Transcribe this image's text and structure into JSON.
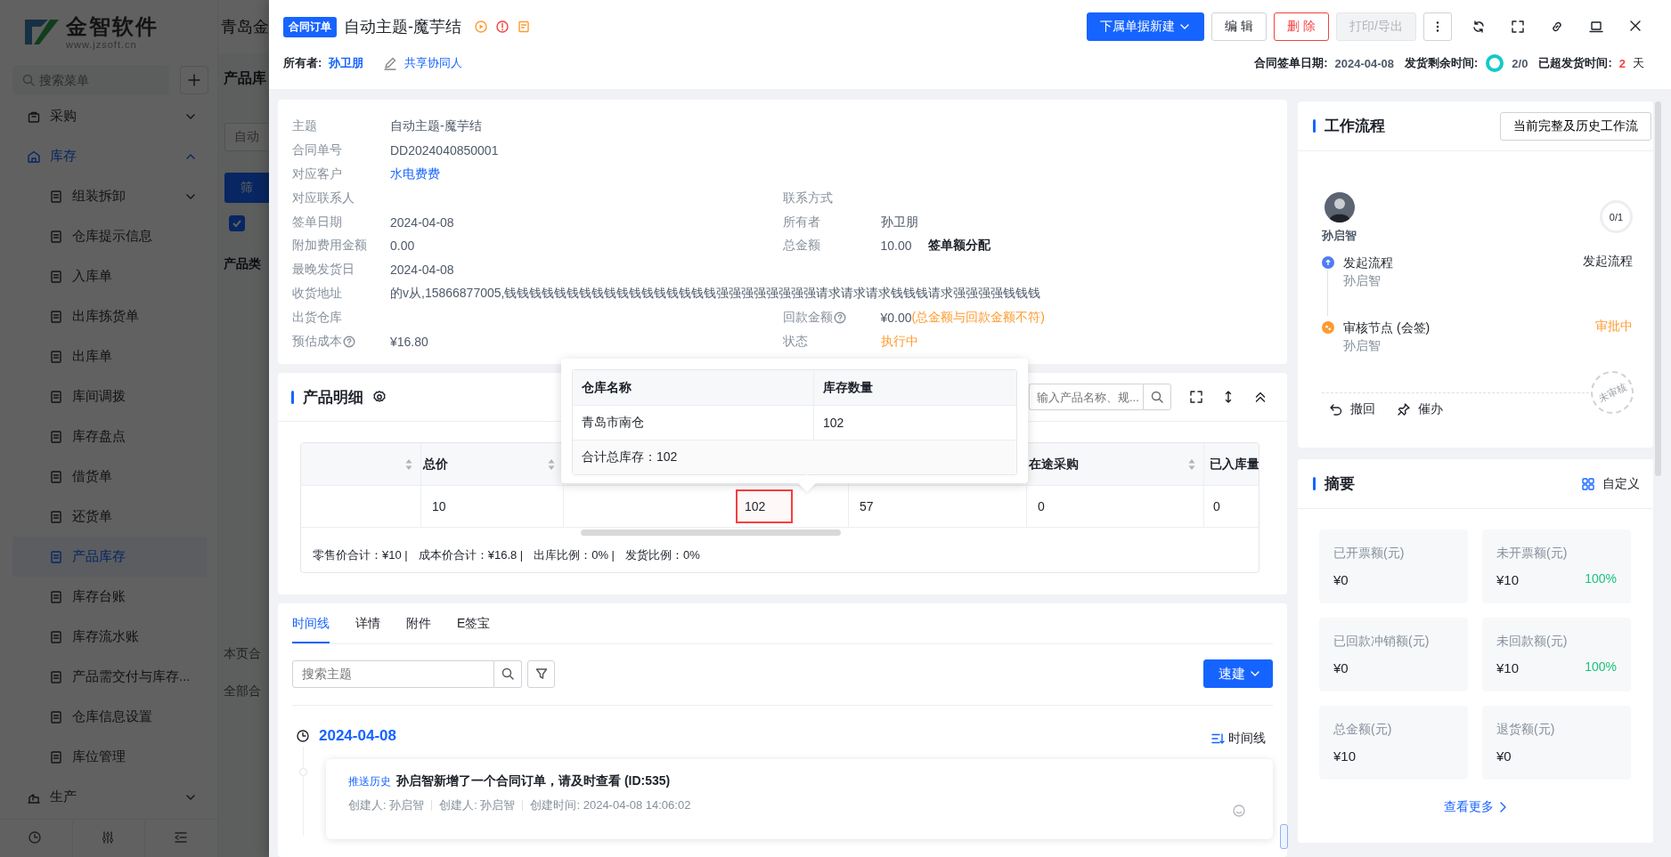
{
  "background": {
    "logo": {
      "name": "金智软件",
      "url": "www.jzsoft.cn"
    },
    "menu_search": {
      "placeholder": "搜索菜单"
    },
    "menu": [
      {
        "label": "采购",
        "selected": false,
        "expanded": false
      },
      {
        "label": "库存",
        "selected": true,
        "expanded": true,
        "children": [
          {
            "label": "组装拆卸",
            "kind": "group",
            "expanded": false,
            "selected": false
          },
          {
            "label": "仓库提示信息",
            "kind": "item",
            "selected": false
          },
          {
            "label": "入库单",
            "kind": "item",
            "selected": false
          },
          {
            "label": "出库拣货单",
            "kind": "item",
            "selected": false
          },
          {
            "label": "出库单",
            "kind": "item",
            "selected": false
          },
          {
            "label": "库间调拨",
            "kind": "item",
            "selected": false
          },
          {
            "label": "库存盘点",
            "kind": "item",
            "selected": false
          },
          {
            "label": "借货单",
            "kind": "item",
            "selected": false
          },
          {
            "label": "还货单",
            "kind": "item",
            "selected": false
          },
          {
            "label": "产品库存",
            "kind": "item",
            "selected": true
          },
          {
            "label": "库存台账",
            "kind": "item",
            "selected": false
          },
          {
            "label": "库存流水账",
            "kind": "item",
            "selected": false
          },
          {
            "label": "产品需交付与库存...",
            "kind": "item",
            "selected": false
          },
          {
            "label": "仓库信息设置",
            "kind": "item",
            "selected": false
          },
          {
            "label": "库位管理",
            "kind": "item",
            "selected": false
          }
        ]
      },
      {
        "label": "生产",
        "selected": false,
        "expanded": false
      }
    ],
    "page": {
      "title": "青岛金",
      "subtitle": "产品库",
      "fields": [
        {
          "placeholder": "自动"
        }
      ],
      "filter_button": "筛",
      "checkbox": {
        "checked": true
      },
      "column_header": "产品类",
      "footer": [
        "本页合",
        "全部合"
      ]
    }
  },
  "drawer": {
    "header": {
      "tag": "合同订单",
      "title": "自动主题-魔芋结",
      "buttons": [
        {
          "label": "下属单据新建",
          "kind": "primary",
          "dropdown": true,
          "disabled": false
        },
        {
          "label": "编 辑",
          "kind": "default",
          "dropdown": false,
          "disabled": false
        },
        {
          "label": "删 除",
          "kind": "danger",
          "dropdown": false,
          "disabled": false
        },
        {
          "label": "打印/导出",
          "kind": "default",
          "dropdown": false,
          "disabled": true
        }
      ],
      "owner_label": "所有者:",
      "owner": "孙卫朋",
      "share": "共享协同人",
      "meta": [
        {
          "label": "合同签单日期:",
          "value": "2024-04-08",
          "kind": "text"
        },
        {
          "label": "发货剩余时间:",
          "value": "2/0",
          "kind": "ring"
        },
        {
          "label": "已超发货时间:",
          "value": "2",
          "unit": "天",
          "kind": "overdue"
        }
      ]
    },
    "info": {
      "rows": [
        {
          "fields": [
            {
              "label": "主题",
              "value": "自动主题-魔芋结",
              "kind": "plain"
            }
          ]
        },
        {
          "fields": [
            {
              "label": "合同单号",
              "value": "DD2024040850001",
              "kind": "plain"
            }
          ]
        },
        {
          "fields": [
            {
              "label": "对应客户",
              "value": "水电费费",
              "kind": "link"
            }
          ]
        },
        {
          "fields": [
            {
              "label": "对应联系人"
            },
            {
              "label": "联系方式"
            }
          ]
        },
        {
          "fields": [
            {
              "label": "签单日期",
              "value": "2024-04-08",
              "kind": "plain"
            },
            {
              "label": "所有者",
              "value": "孙卫朋",
              "kind": "plain"
            }
          ]
        },
        {
          "fields": [
            {
              "label": "附加费用金额",
              "value": "0.00",
              "kind": "plain"
            },
            {
              "label": "总金额",
              "value": "10.00",
              "kind": "plain",
              "action": "签单额分配"
            }
          ]
        },
        {
          "fields": [
            {
              "label": "最晚发货日",
              "value": "2024-04-08",
              "kind": "plain"
            }
          ]
        },
        {
          "fields": [
            {
              "label": "收货地址",
              "value": "的v从,15866877005,钱钱钱钱钱钱钱钱钱钱钱钱钱钱钱钱钱强强强强强强强强请求请求请求钱钱钱请求强强强强钱钱钱",
              "kind": "plain"
            }
          ]
        },
        {
          "fields": [
            {
              "label": "出货仓库"
            },
            {
              "label": "回款金额",
              "value": "¥0.00",
              "kind": "plain",
              "help": true,
              "note": "(总金额与回款金额不符)"
            }
          ]
        },
        {
          "fields": [
            {
              "label": "预估成本",
              "value": "¥16.80",
              "kind": "plain",
              "help": true
            },
            {
              "label": "状态",
              "value": "执行中",
              "kind": "warn"
            }
          ]
        }
      ]
    },
    "products": {
      "title": "产品明细",
      "search": {
        "placeholder": "输入产品名称、规..."
      },
      "columns": [
        {
          "kind": "spacer",
          "sortable": true
        },
        {
          "kind": "header",
          "label": "总价",
          "sortable": true
        },
        {
          "kind": "covered"
        },
        {
          "kind": "covered"
        },
        {
          "kind": "header",
          "label": "在途采购",
          "sortable": true
        },
        {
          "kind": "header",
          "label": "已入库量"
        }
      ],
      "rows": [
        {
          "cells": [
            {
              "text": ""
            },
            {
              "text": "10",
              "highlighted": false
            },
            {
              "text": "102",
              "highlighted": true
            },
            {
              "text": "57",
              "highlighted": false
            },
            {
              "text": "0",
              "highlighted": false
            },
            {
              "text": "0",
              "highlighted": false
            }
          ]
        }
      ],
      "totals": [
        "零售价合计：¥10 |",
        "成本价合计：¥16.8 |",
        "出库比例：0% |",
        "发货比例：0%"
      ],
      "stock_popup": {
        "columns": [
          "仓库名称",
          "库存数量"
        ],
        "rows": [
          [
            "青岛市南仓",
            "102"
          ]
        ],
        "total": "合计总库存：102"
      }
    },
    "timeline": {
      "tabs": [
        {
          "label": "时间线",
          "selected": true
        },
        {
          "label": "详情",
          "selected": false
        },
        {
          "label": "附件",
          "selected": false
        },
        {
          "label": "E签宝",
          "selected": false
        }
      ],
      "search": {
        "placeholder": "搜索主题"
      },
      "quick_create": "速建",
      "view_label": "时间线",
      "groups": [
        {
          "date": "2024-04-08",
          "entries": [
            {
              "tag": "推送历史",
              "text": "孙启智新增了一个合同订单，请及时查看 (ID:535)",
              "meta": [
                "创建人: 孙启智",
                "创建人: 孙启智",
                "创建时间: 2024-04-08 14:06:02"
              ]
            }
          ]
        }
      ]
    },
    "workflow": {
      "title": "工作流程",
      "history_button": "当前完整及历史工作流",
      "initiator": "孙启智",
      "progress": "0/1",
      "steps": [
        {
          "name": "发起流程",
          "person": "孙启智",
          "status": "发起流程",
          "kind": "start"
        },
        {
          "name": "审核节点 (会签)",
          "person": "孙启智",
          "status": "审批中",
          "kind": "review"
        }
      ],
      "stamp": "未审核",
      "actions": [
        {
          "label": "撤回",
          "kind": "undo"
        },
        {
          "label": "催办",
          "kind": "pin"
        }
      ]
    },
    "summary": {
      "title": "摘要",
      "customize": "自定义",
      "more": "查看更多",
      "tiles": [
        {
          "label": "已开票额(元)",
          "value": "¥0"
        },
        {
          "label": "未开票额(元)",
          "value": "¥10",
          "percent": "100%"
        },
        {
          "label": "已回款冲销额(元)",
          "value": "¥0"
        },
        {
          "label": "未回款额(元)",
          "value": "¥10",
          "percent": "100%"
        },
        {
          "label": "总金额(元)",
          "value": "¥10"
        },
        {
          "label": "退货额(元)",
          "value": "¥0"
        }
      ]
    }
  }
}
